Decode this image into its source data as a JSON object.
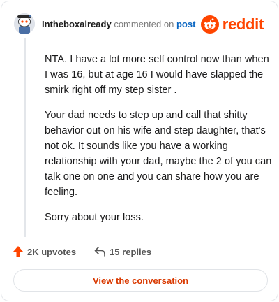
{
  "header": {
    "username": "Intheboxalready",
    "action_text": "commented on",
    "target_text": "post",
    "logo_text": "reddit",
    "brand_color": "#ff4500"
  },
  "comment": {
    "paragraphs": [
      "NTA. I have a lot more self control now than when I was 16, but at age 16 I would have slapped the smirk right off my step sister .",
      "Your dad needs to step up and call that shitty behavior out on his wife and step daughter, that's not ok. It sounds like you have a working relationship with your dad, maybe the 2 of you can talk one on one and you can share how you are feeling.",
      "Sorry about your loss."
    ]
  },
  "footer": {
    "upvotes_label": "2K upvotes",
    "replies_label": "15 replies",
    "cta_label": "View the conversation",
    "upvote_icon": "upvote-arrow-icon",
    "reply_icon": "reply-arrow-icon"
  }
}
